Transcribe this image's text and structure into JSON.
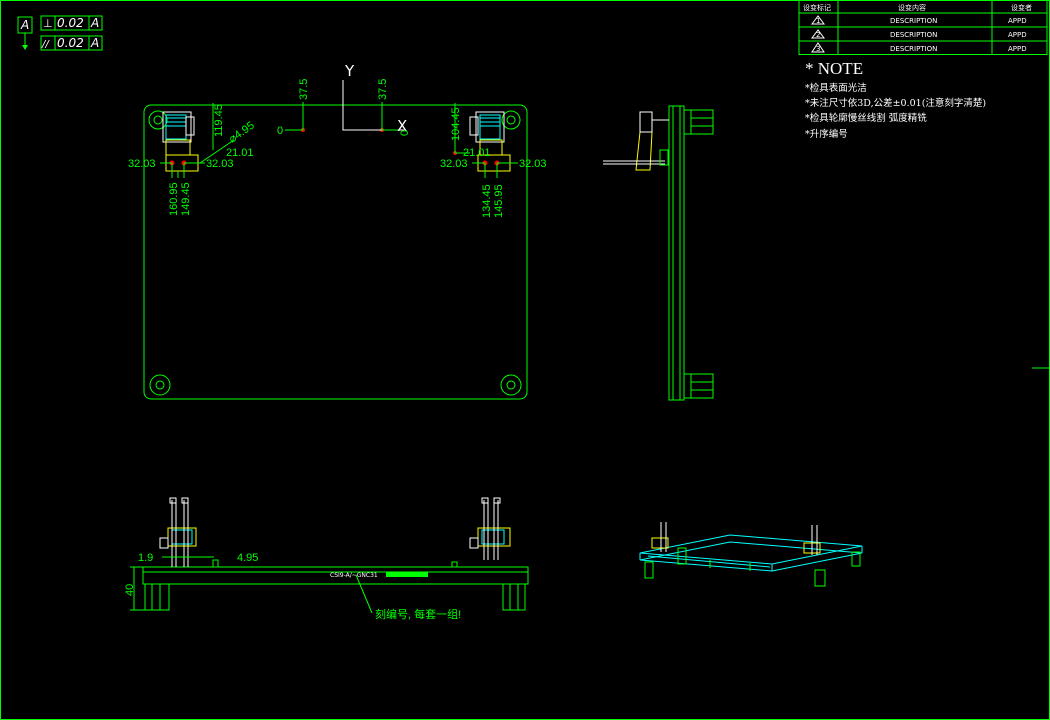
{
  "gdt": {
    "datum": "A",
    "perpendicularity": {
      "symbol": "⊥",
      "tolerance": "0.02",
      "datum": "A"
    },
    "parallelism": {
      "symbol": "//",
      "tolerance": "0.02",
      "datum": "A"
    }
  },
  "revision_table": {
    "headers": [
      "设变标记",
      "设变内容",
      "设变者"
    ],
    "rows": [
      {
        "mark": "1",
        "content": "DESCRIPTION",
        "by": "APPD"
      },
      {
        "mark": "2",
        "content": "DESCRIPTION",
        "by": "APPD"
      },
      {
        "mark": "3",
        "content": "DESCRIPTION",
        "by": "APPD"
      }
    ]
  },
  "notes": {
    "title": "* NOTE",
    "lines": [
      "*检具表面光洁",
      "*未注尺寸依3D,公差±0.01(注意刻字清楚)",
      "*检具轮廓慢丝线割 弧度精铣",
      "*升序编号"
    ]
  },
  "axes": {
    "y": "Y",
    "x": "X"
  },
  "top_view_dims": {
    "origin_x_zero": "0",
    "origin_x_37_5": "37.5",
    "origin_y_37_5": "37.5",
    "origin_y_zero": "0",
    "left_119_45": "119.45",
    "left_dia_4_95": "⌀4.95",
    "left_21_01": "21.01",
    "left_32_03_a": "32.03",
    "left_32_03_b": "32.03",
    "left_160_95": "160.95",
    "left_149_45": "149.45",
    "right_104_45": "104.45",
    "right_21_01": "21.01",
    "right_32_03_a": "32.03",
    "right_32_03_b": "32.03",
    "right_134_45": "134.45",
    "right_145_95": "145.95"
  },
  "front_view_dims": {
    "d_1_9": "1.9",
    "d_4_95": "4.95",
    "d_40": "40",
    "part_number": "CSI9-A/~GNC31",
    "engrave_note": "刻编号, 每套一组!"
  },
  "colors": {
    "outline": "#00ff00",
    "dimension": "#00ff00",
    "part": "#ffff00",
    "cyan": "#00ffff",
    "white": "#ffffff",
    "red": "#ff0000",
    "background": "#000000"
  }
}
